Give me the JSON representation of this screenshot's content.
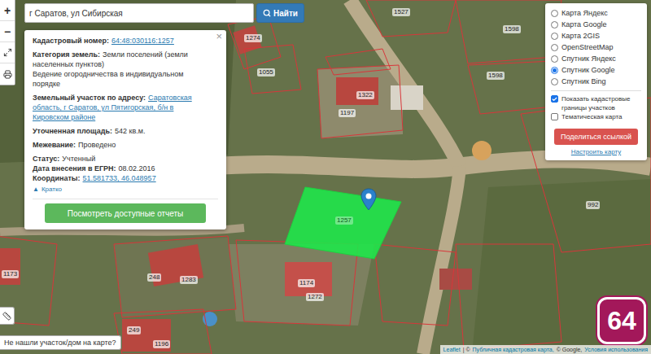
{
  "search": {
    "value": "г Саратов, ул Сибирская",
    "button": "Найти"
  },
  "zoom": {
    "in": "+",
    "out": "−"
  },
  "popup": {
    "close": "×",
    "groups": [
      [
        {
          "label": "Кадастровый номер:",
          "value": "64:48:030116:1257",
          "link": true
        }
      ],
      [
        {
          "label": "Категория земель:",
          "value": "Земли поселений (земли населенных пунктов)",
          "link": false
        },
        {
          "label": "",
          "value": "Ведение огородничества в индивидуальном порядке",
          "link": false
        }
      ],
      [
        {
          "label": "Земельный участок по адресу:",
          "value": "Саратовская область, г Саратов, ул Пятигорская, б/н в Кировском районе",
          "link": true
        }
      ],
      [
        {
          "label": "Уточненная площадь:",
          "value": "542 кв.м.",
          "link": false
        }
      ],
      [
        {
          "label": "Межевание:",
          "value": "Проведено",
          "link": false
        }
      ],
      [
        {
          "label": "Статус:",
          "value": "Учтенный",
          "link": false
        },
        {
          "label": "Дата внесения в ЕГРН:",
          "value": "08.02.2016",
          "link": false
        },
        {
          "label": "Координаты:",
          "value": "51.581733, 46.048957",
          "link": true
        }
      ]
    ],
    "collapse": {
      "icon": "▲",
      "label": "Кратко"
    },
    "button": "Посмотреть доступные отчеты"
  },
  "layers": [
    {
      "label": "Карта Яндекс",
      "selected": false
    },
    {
      "label": "Карта Google",
      "selected": false
    },
    {
      "label": "Карта 2GIS",
      "selected": false
    },
    {
      "label": "OpenStreetMap",
      "selected": false
    },
    {
      "label": "Спутник Яндекс",
      "selected": false
    },
    {
      "label": "Спутник Google",
      "selected": true
    },
    {
      "label": "Спутник Bing",
      "selected": false
    }
  ],
  "options": [
    {
      "label": "Показать кадастровые границы участков",
      "checked": true
    },
    {
      "label": "Тематическая карта",
      "checked": false
    }
  ],
  "share_button": "Поделиться ссылкой",
  "settings_link": "Настроить карту",
  "parcels": [
    {
      "label": "1527",
      "selected": false
    },
    {
      "label": "1274",
      "selected": false
    },
    {
      "label": "1055",
      "selected": false
    },
    {
      "label": "1598",
      "selected": false
    },
    {
      "label": "1598",
      "selected": false
    },
    {
      "label": "1322",
      "selected": false
    },
    {
      "label": "1197",
      "selected": false
    },
    {
      "label": "1257",
      "selected": true
    },
    {
      "label": "992",
      "selected": false
    },
    {
      "label": "1173",
      "selected": false
    },
    {
      "label": "248",
      "selected": false
    },
    {
      "label": "1283",
      "selected": false
    },
    {
      "label": "1174",
      "selected": false
    },
    {
      "label": "1272",
      "selected": false
    },
    {
      "label": "249",
      "selected": false
    },
    {
      "label": "1196",
      "selected": false
    }
  ],
  "not_found": "Не нашли участок/дом на карте?",
  "attribution": [
    {
      "text": "Leaflet",
      "link": true
    },
    {
      "text": "| ©",
      "link": false
    },
    {
      "text": "Публичная кадастровая карта,",
      "link": true
    },
    {
      "text": "© Google,",
      "link": false
    },
    {
      "text": "Условия использования",
      "link": true
    }
  ],
  "logo": "64"
}
